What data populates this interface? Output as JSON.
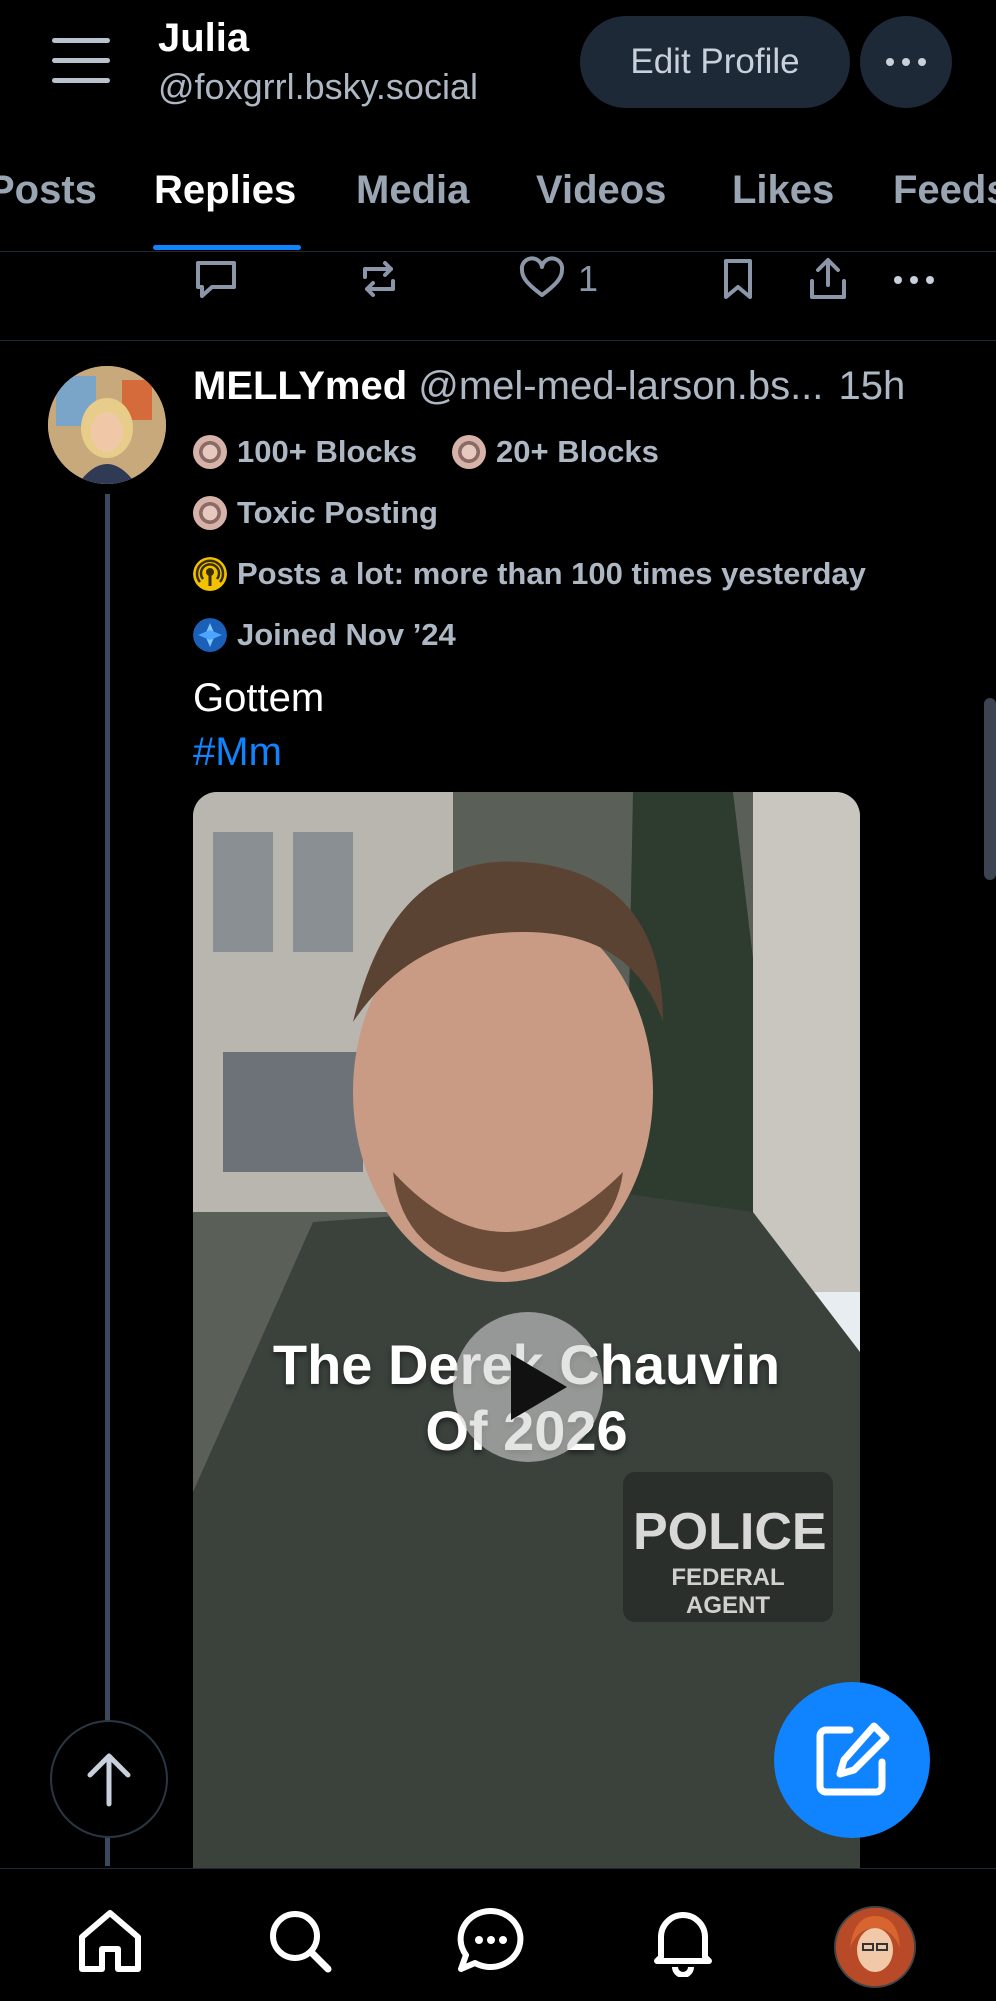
{
  "header": {
    "name": "Julia",
    "handle": "@foxgrrl.bsky.social",
    "edit_profile_label": "Edit Profile",
    "menu_icon": "hamburger-icon",
    "more_icon": "ellipsis-icon"
  },
  "tabs": [
    {
      "label": "Posts",
      "active": false
    },
    {
      "label": "Replies",
      "active": true
    },
    {
      "label": "Media",
      "active": false
    },
    {
      "label": "Videos",
      "active": false
    },
    {
      "label": "Likes",
      "active": false
    },
    {
      "label": "Feeds",
      "active": false
    }
  ],
  "prev_post_actions": {
    "icons": [
      "reply-icon",
      "repost-icon",
      "like-icon",
      "bookmark-icon",
      "share-icon",
      "more-icon"
    ],
    "like_count": "1"
  },
  "post": {
    "author_name": "MELLYmed",
    "author_handle": "@mel-med-larson.bs...",
    "time": "15h",
    "labels": [
      {
        "text": "100+ Blocks",
        "icon": "block-badge-icon"
      },
      {
        "text": "20+ Blocks",
        "icon": "block-badge-icon"
      },
      {
        "text": "Toxic Posting",
        "icon": "block-badge-icon"
      },
      {
        "text": "Posts a lot: more than 100 times yesterday",
        "icon": "broadcast-badge-icon"
      },
      {
        "text": "Joined Nov ’24",
        "icon": "new-user-badge-icon"
      }
    ],
    "text": "Gottem",
    "hashtag": "#Mm",
    "video": {
      "overlay_text_line1": "The Derek Chauvin",
      "overlay_text_line2": "Of 2026",
      "vest_text_1": "POLICE",
      "vest_text_2": "FEDERAL AGENT",
      "play_icon": "play-icon"
    }
  },
  "fab": {
    "compose_icon": "compose-icon",
    "scroll_top_icon": "arrow-up-icon"
  },
  "bottom_nav": [
    "home-icon",
    "search-icon",
    "chat-icon",
    "bell-icon",
    "profile-avatar"
  ],
  "colors": {
    "accent": "#1083fe",
    "background": "#000000",
    "muted": "#aeb7c4",
    "button_bg": "#1e2937"
  }
}
